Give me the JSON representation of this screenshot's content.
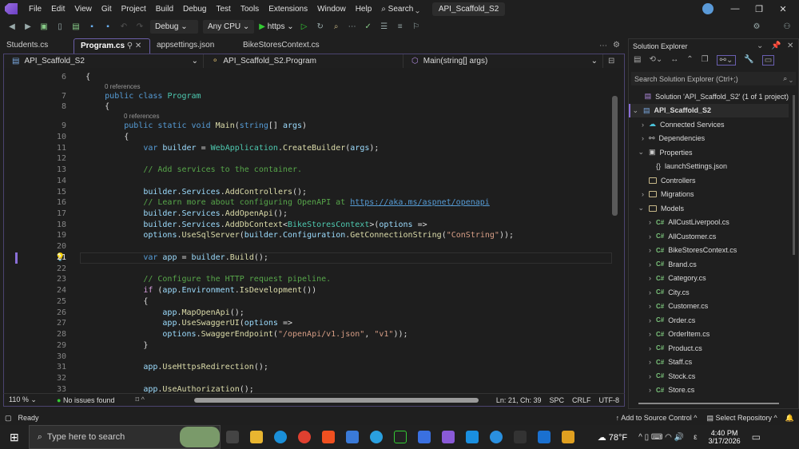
{
  "titlebar": {
    "menus": [
      "File",
      "Edit",
      "View",
      "Git",
      "Project",
      "Build",
      "Debug",
      "Test",
      "Tools",
      "Extensions",
      "Window",
      "Help"
    ],
    "search": "Search",
    "solution_name": "API_Scaffold_S2"
  },
  "toolbar": {
    "config": "Debug",
    "platform": "Any CPU",
    "run_target": "https"
  },
  "tabs": [
    {
      "label": "Students.cs"
    },
    {
      "label": "Program.cs"
    },
    {
      "label": "appsettings.json"
    },
    {
      "label": "BikeStoresContext.cs"
    }
  ],
  "navbar": {
    "project": "API_Scaffold_S2",
    "type": "API_Scaffold_S2.Program",
    "member": "Main(string[] args)"
  },
  "code": [
    {
      "n": "6",
      "t": [
        [
          "tx",
          "    {"
        ]
      ]
    },
    {
      "n": "7",
      "lens": "0 references",
      "t": [
        [
          "kw",
          "        public class "
        ],
        [
          "ty",
          "Program"
        ]
      ]
    },
    {
      "n": "8",
      "t": [
        [
          "tx",
          "        {"
        ]
      ]
    },
    {
      "n": "9",
      "lens": "0 references",
      "t": [
        [
          "kw",
          "            public static void "
        ],
        [
          "me",
          "Main"
        ],
        [
          "tx",
          "("
        ],
        [
          "kw",
          "string"
        ],
        [
          "tx",
          "[] "
        ],
        [
          "va",
          "args"
        ],
        [
          "tx",
          ")"
        ]
      ]
    },
    {
      "n": "10",
      "t": [
        [
          "tx",
          "            {"
        ]
      ]
    },
    {
      "n": "11",
      "t": [
        [
          "kw",
          "                var "
        ],
        [
          "va",
          "builder"
        ],
        [
          "tx",
          " = "
        ],
        [
          "ty",
          "WebApplication"
        ],
        [
          "tx",
          "."
        ],
        [
          "me",
          "CreateBuilder"
        ],
        [
          "tx",
          "("
        ],
        [
          "va",
          "args"
        ],
        [
          "tx",
          ");"
        ]
      ]
    },
    {
      "n": "12",
      "t": []
    },
    {
      "n": "13",
      "t": [
        [
          "cm",
          "                // Add services to the container."
        ]
      ]
    },
    {
      "n": "14",
      "t": []
    },
    {
      "n": "15",
      "t": [
        [
          "va",
          "                builder"
        ],
        [
          "tx",
          "."
        ],
        [
          "va",
          "Services"
        ],
        [
          "tx",
          "."
        ],
        [
          "me",
          "AddControllers"
        ],
        [
          "tx",
          "();"
        ]
      ]
    },
    {
      "n": "16",
      "t": [
        [
          "cm",
          "                // Learn more about configuring OpenAPI at "
        ],
        [
          "lk",
          "https://aka.ms/aspnet/openapi"
        ]
      ]
    },
    {
      "n": "17",
      "t": [
        [
          "va",
          "                builder"
        ],
        [
          "tx",
          "."
        ],
        [
          "va",
          "Services"
        ],
        [
          "tx",
          "."
        ],
        [
          "me",
          "AddOpenApi"
        ],
        [
          "tx",
          "();"
        ]
      ]
    },
    {
      "n": "18",
      "t": [
        [
          "va",
          "                builder"
        ],
        [
          "tx",
          "."
        ],
        [
          "va",
          "Services"
        ],
        [
          "tx",
          "."
        ],
        [
          "me",
          "AddDbContext"
        ],
        [
          "tx",
          "<"
        ],
        [
          "ty",
          "BikeStoresContext"
        ],
        [
          "tx",
          ">("
        ],
        [
          "va",
          "options"
        ],
        [
          "tx",
          " =>"
        ]
      ]
    },
    {
      "n": "19",
      "t": [
        [
          "va",
          "                options"
        ],
        [
          "tx",
          "."
        ],
        [
          "me",
          "UseSqlServer"
        ],
        [
          "tx",
          "("
        ],
        [
          "va",
          "builder"
        ],
        [
          "tx",
          "."
        ],
        [
          "va",
          "Configuration"
        ],
        [
          "tx",
          "."
        ],
        [
          "me",
          "GetConnectionString"
        ],
        [
          "tx",
          "("
        ],
        [
          "st",
          "\"ConString\""
        ],
        [
          "tx",
          "));"
        ]
      ]
    },
    {
      "n": "20",
      "t": []
    },
    {
      "n": "21",
      "t": [
        [
          "kw",
          "                var "
        ],
        [
          "va",
          "app"
        ],
        [
          "tx",
          " = "
        ],
        [
          "va",
          "builder"
        ],
        [
          "tx",
          "."
        ],
        [
          "me",
          "Build"
        ],
        [
          "tx",
          "();"
        ]
      ]
    },
    {
      "n": "22",
      "t": []
    },
    {
      "n": "23",
      "t": [
        [
          "cm",
          "                // Configure the HTTP request pipeline."
        ]
      ]
    },
    {
      "n": "24",
      "t": [
        [
          "ct",
          "                if "
        ],
        [
          "tx",
          "("
        ],
        [
          "va",
          "app"
        ],
        [
          "tx",
          "."
        ],
        [
          "va",
          "Environment"
        ],
        [
          "tx",
          "."
        ],
        [
          "me",
          "IsDevelopment"
        ],
        [
          "tx",
          "())"
        ]
      ]
    },
    {
      "n": "25",
      "t": [
        [
          "tx",
          "                {"
        ]
      ]
    },
    {
      "n": "26",
      "t": [
        [
          "va",
          "                    app"
        ],
        [
          "tx",
          "."
        ],
        [
          "me",
          "MapOpenApi"
        ],
        [
          "tx",
          "();"
        ]
      ]
    },
    {
      "n": "27",
      "t": [
        [
          "va",
          "                    app"
        ],
        [
          "tx",
          "."
        ],
        [
          "me",
          "UseSwaggerUI"
        ],
        [
          "tx",
          "("
        ],
        [
          "va",
          "options"
        ],
        [
          "tx",
          " =>"
        ]
      ]
    },
    {
      "n": "28",
      "t": [
        [
          "va",
          "                    options"
        ],
        [
          "tx",
          "."
        ],
        [
          "me",
          "SwaggerEndpoint"
        ],
        [
          "tx",
          "("
        ],
        [
          "st",
          "\"/openApi/v1.json\""
        ],
        [
          "tx",
          ", "
        ],
        [
          "st",
          "\"v1\""
        ],
        [
          "tx",
          "));"
        ]
      ]
    },
    {
      "n": "29",
      "t": [
        [
          "tx",
          "                }"
        ]
      ]
    },
    {
      "n": "30",
      "t": []
    },
    {
      "n": "31",
      "t": [
        [
          "va",
          "                app"
        ],
        [
          "tx",
          "."
        ],
        [
          "me",
          "UseHttpsRedirection"
        ],
        [
          "tx",
          "();"
        ]
      ]
    },
    {
      "n": "32",
      "t": []
    },
    {
      "n": "33",
      "t": [
        [
          "va",
          "                app"
        ],
        [
          "tx",
          "."
        ],
        [
          "me",
          "UseAuthorization"
        ],
        [
          "tx",
          "();"
        ]
      ]
    }
  ],
  "editor_status": {
    "zoom": "110 %",
    "issues": "No issues found",
    "position": "Ln: 21, Ch: 39",
    "spaces": "SPC",
    "line_ending": "CRLF",
    "encoding": "UTF-8"
  },
  "solution_explorer": {
    "title": "Solution Explorer",
    "search_placeholder": "Search Solution Explorer (Ctrl+;)",
    "items": [
      {
        "label": "Solution 'API_Scaffold_S2' (1 of 1 project)",
        "level": 0,
        "chev": "",
        "icon": "solution"
      },
      {
        "label": "API_Scaffold_S2",
        "level": 0,
        "chev": "v",
        "icon": "project",
        "bold": true
      },
      {
        "label": "Connected Services",
        "level": 1,
        "chev": ">",
        "icon": "cloud"
      },
      {
        "label": "Dependencies",
        "level": 1,
        "chev": ">",
        "icon": "deps"
      },
      {
        "label": "Properties",
        "level": 1,
        "chev": "v",
        "icon": "props"
      },
      {
        "label": "launchSettings.json",
        "level": 2,
        "chev": "",
        "icon": "json"
      },
      {
        "label": "Controllers",
        "level": 1,
        "chev": "",
        "icon": "folder"
      },
      {
        "label": "Migrations",
        "level": 1,
        "chev": ">",
        "icon": "folder"
      },
      {
        "label": "Models",
        "level": 1,
        "chev": "v",
        "icon": "folder"
      },
      {
        "label": "AllCustLiverpool.cs",
        "level": 2,
        "chev": ">",
        "icon": "cs"
      },
      {
        "label": "AllCustomer.cs",
        "level": 2,
        "chev": ">",
        "icon": "cs"
      },
      {
        "label": "BikeStoresContext.cs",
        "level": 2,
        "chev": ">",
        "icon": "cs"
      },
      {
        "label": "Brand.cs",
        "level": 2,
        "chev": ">",
        "icon": "cs"
      },
      {
        "label": "Category.cs",
        "level": 2,
        "chev": ">",
        "icon": "cs"
      },
      {
        "label": "City.cs",
        "level": 2,
        "chev": ">",
        "icon": "cs"
      },
      {
        "label": "Customer.cs",
        "level": 2,
        "chev": ">",
        "icon": "cs"
      },
      {
        "label": "Order.cs",
        "level": 2,
        "chev": ">",
        "icon": "cs"
      },
      {
        "label": "OrderItem.cs",
        "level": 2,
        "chev": ">",
        "icon": "cs"
      },
      {
        "label": "Product.cs",
        "level": 2,
        "chev": ">",
        "icon": "cs"
      },
      {
        "label": "Staff.cs",
        "level": 2,
        "chev": ">",
        "icon": "cs"
      },
      {
        "label": "Stock.cs",
        "level": 2,
        "chev": ">",
        "icon": "cs"
      },
      {
        "label": "Store.cs",
        "level": 2,
        "chev": ">",
        "icon": "cs"
      }
    ]
  },
  "statusbar": {
    "ready": "Ready",
    "source_control": "Add to Source Control",
    "repository": "Select Repository"
  },
  "taskbar": {
    "search_placeholder": "Type here to search",
    "weather": "78°F",
    "time": "4:40 PM",
    "date": "3/17/2026",
    "lang": "ε"
  },
  "icons": {
    "cs_glyph": "C#"
  }
}
